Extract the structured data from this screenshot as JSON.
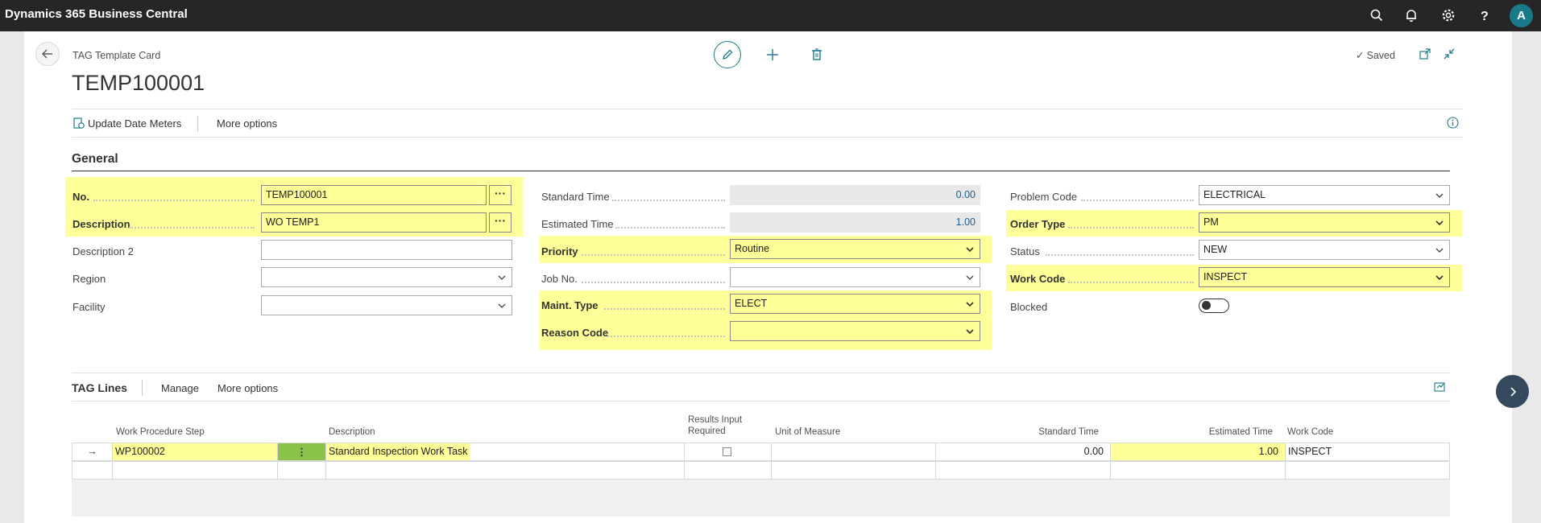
{
  "app": {
    "title": "Dynamics 365 Business Central",
    "icons": [
      "search-icon",
      "bell-icon",
      "gear-icon",
      "help-icon"
    ],
    "avatar_initial": "A"
  },
  "page": {
    "breadcrumb": "TAG Template Card",
    "record_title": "TEMP100001",
    "saved_label": "Saved"
  },
  "actions": {
    "update_date_meters": "Update Date Meters",
    "more_options": "More options"
  },
  "general": {
    "title": "General",
    "col1": [
      {
        "label": "No.",
        "value": "TEMP100001",
        "highlight": true
      },
      {
        "label": "Description",
        "value": "WO TEMP1",
        "highlight": true
      },
      {
        "label": "Description 2",
        "value": "",
        "highlight": false
      },
      {
        "label": "Region",
        "value": "",
        "highlight": false
      },
      {
        "label": "Facility",
        "value": "",
        "highlight": false
      }
    ],
    "col2": [
      {
        "label": "Standard Time",
        "value": "0.00"
      },
      {
        "label": "Estimated Time",
        "value": "1.00"
      },
      {
        "label": "Priority",
        "value": "Routine"
      },
      {
        "label": "Job No.",
        "value": ""
      },
      {
        "label": "Maint. Type",
        "value": "ELECT"
      },
      {
        "label": "Reason Code",
        "value": ""
      }
    ],
    "col3": [
      {
        "label": "Problem Code",
        "value": "ELECTRICAL"
      },
      {
        "label": "Order Type",
        "value": "PM"
      },
      {
        "label": "Status",
        "value": "NEW"
      },
      {
        "label": "Work Code",
        "value": "INSPECT"
      },
      {
        "label": "Blocked",
        "value": ""
      }
    ],
    "ellipsis": "···"
  },
  "lines": {
    "title": "TAG Lines",
    "manage": "Manage",
    "more_options": "More options",
    "columns": {
      "step": "Work Procedure Step",
      "description": "Description",
      "results_input": "Results Input Required",
      "uom": "Unit of Measure",
      "standard_time": "Standard Time",
      "estimated_time": "Estimated Time",
      "work_code": "Work Code"
    },
    "rows": [
      {
        "step": "WP100002",
        "menu": "⋮",
        "description": "Standard Inspection Work Task",
        "uom": "",
        "standard_time": "0.00",
        "estimated_time": "1.00",
        "work_code": "INSPECT"
      }
    ]
  },
  "colors": {
    "highlight": "#ffff99",
    "accent": "#1d7a8a",
    "topbar": "#262626"
  }
}
